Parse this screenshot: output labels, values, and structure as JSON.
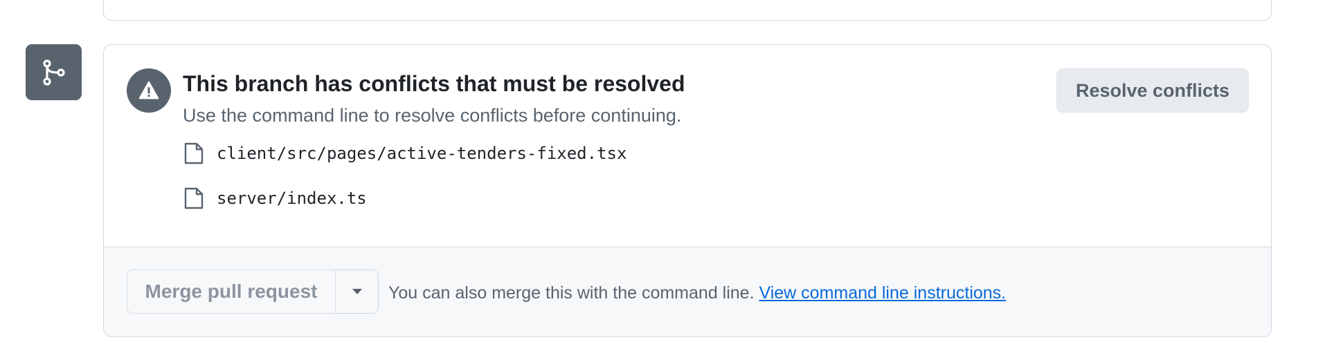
{
  "conflict": {
    "title": "This branch has conflicts that must be resolved",
    "subtitle": "Use the command line to resolve conflicts before continuing.",
    "resolve_button": "Resolve conflicts",
    "files": [
      {
        "path": "client/src/pages/active-tenders-fixed.tsx",
        "icon": "file-icon"
      },
      {
        "path": "server/index.ts",
        "icon": "file-icon"
      }
    ]
  },
  "merge": {
    "button_label": "Merge pull request",
    "dropdown_icon": "triangle-down-icon",
    "help_text": "You can also merge this with the command line.",
    "link_text": "View command line instructions."
  },
  "icons": {
    "badge": "git-branch-icon",
    "alert": "alert-icon"
  },
  "colors": {
    "badge_bg": "#59636e",
    "link": "#0969da",
    "footer_bg": "#f6f8fa",
    "border": "#d0d7de"
  }
}
